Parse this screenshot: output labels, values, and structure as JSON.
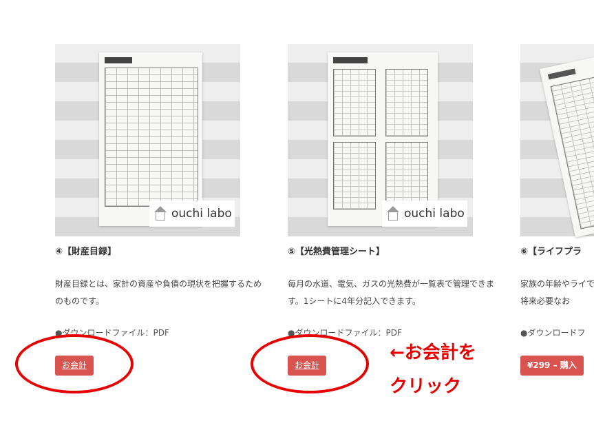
{
  "products": [
    {
      "title": "④【財産目録】",
      "desc": "財産目録とは、家計の資産や負債の現状を把握するためのものです。",
      "download": "●ダウンロードファイル：PDF",
      "button": "お会計",
      "logo": "ouchi labo"
    },
    {
      "title": "⑤【光熱費管理シート】",
      "desc": "毎月の水道、電気、ガスの光熱費が一覧表で管理できます。1シートに4年分記入できます。",
      "download": "●ダウンロードファイル：PDF",
      "button": "お会計",
      "logo": "ouchi labo"
    },
    {
      "title": "⑥【ライフプラ",
      "desc": "家族の年齢やライで、将来必要なお",
      "download": "●ダウンロードフ",
      "button": "¥299 – 購入"
    }
  ],
  "annotation": {
    "line1": "←お会計を",
    "line2": "クリック",
    "color": "#e60000"
  },
  "colors": {
    "button": "#d9534f",
    "annotation": "#e60000"
  },
  "icons": [
    "house-logo-icon"
  ]
}
